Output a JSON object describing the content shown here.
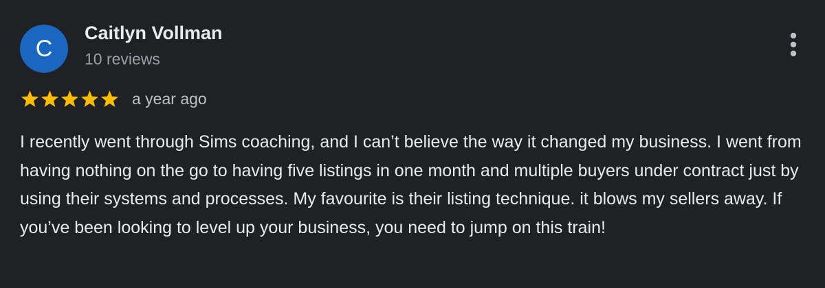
{
  "review": {
    "author": {
      "initial": "C",
      "name": "Caitlyn Vollman",
      "reviews_count": "10 reviews",
      "avatar_color": "#1a67c2"
    },
    "rating": {
      "stars": 5,
      "max_stars": 5,
      "star_color": "#fbbc04",
      "time": "a year ago"
    },
    "more_icon": "more-vert-icon",
    "text": "I recently went through Sims coaching, and I can’t believe the way it changed my business. I went from having nothing on the go to having five listings in one month and multiple buyers under contract just by using their systems and processes. My favourite is their listing technique. it blows my sellers away. If you’ve been looking to level up your business, you need to jump on this train!"
  }
}
